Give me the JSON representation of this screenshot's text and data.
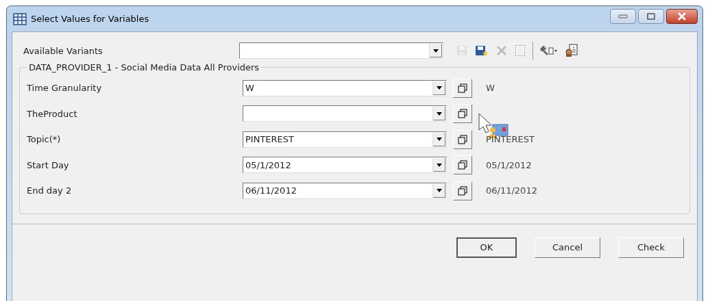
{
  "window": {
    "title": "Select Values for Variables"
  },
  "variants": {
    "label": "Available Variants"
  },
  "toolbar": [
    {
      "kind": "save",
      "disabled": true
    },
    {
      "kind": "save-as",
      "disabled": false
    },
    {
      "kind": "delete",
      "disabled": true
    },
    {
      "kind": "list",
      "disabled": true
    },
    {
      "kind": "separator"
    },
    {
      "kind": "tools",
      "disabled": false
    },
    {
      "kind": "personalize",
      "disabled": false
    }
  ],
  "group": {
    "title": "DATA_PROVIDER_1 - Social Media Data All Providers",
    "rows": [
      {
        "label": "Time Granularity",
        "value": "W",
        "display": "W",
        "drag": false
      },
      {
        "label": "TheProduct",
        "drag": true
      },
      {
        "label": "Topic(*)",
        "value": "PINTEREST",
        "display": "PINTEREST",
        "drag": false
      },
      {
        "label": "Start Day",
        "value": "05/1/2012",
        "display": "05/1/2012",
        "drag": false
      },
      {
        "label": "End day 2",
        "value": "06/11/2012",
        "display": "06/11/2012",
        "drag": false
      }
    ]
  },
  "buttons": [
    {
      "label": "OK",
      "default": true
    },
    {
      "label": "Cancel",
      "default": false
    },
    {
      "label": "Check",
      "default": false
    }
  ]
}
